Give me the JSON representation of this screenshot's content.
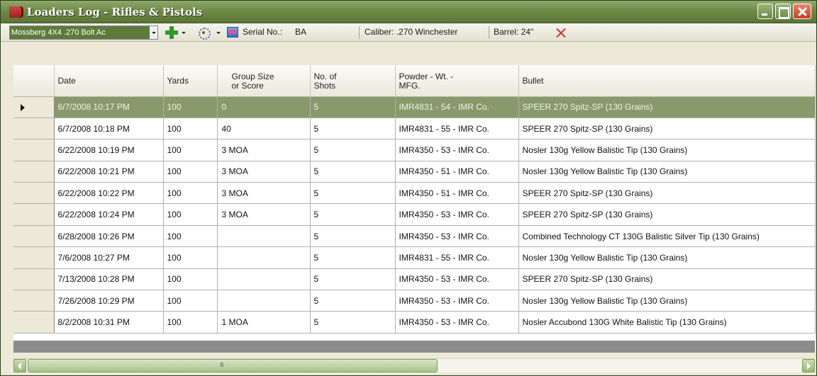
{
  "window": {
    "title": "Loaders Log - Rifles & Pistols"
  },
  "toolbar": {
    "firearm": "Mossberg 4X4 .270 Bolt Ac",
    "serial_label": "Serial No.:",
    "serial_value": "BA",
    "caliber": "Caliber: .270 Winchester",
    "barrel": "Barrel: 24\""
  },
  "columns": [
    "Date",
    "Yards",
    "Group Size\nor Score",
    "No. of\nShots",
    "Powder - Wt. -\nMFG.",
    "Bullet"
  ],
  "rows": [
    {
      "date": "6/7/2008 10:17 PM",
      "yards": "100",
      "group": "0",
      "shots": "5",
      "powder": "IMR4831 - 54 - IMR Co.",
      "bullet": "SPEER 270 Spitz-SP (130 Grains)"
    },
    {
      "date": "6/7/2008 10:18 PM",
      "yards": "100",
      "group": "40",
      "shots": "5",
      "powder": "IMR4831 - 55 - IMR Co.",
      "bullet": "SPEER 270 Spitz-SP (130 Grains)"
    },
    {
      "date": "6/22/2008 10:19 PM",
      "yards": "100",
      "group": "3 MOA",
      "shots": "5",
      "powder": "IMR4350 - 53 - IMR Co.",
      "bullet": "Nosler 130g Yellow Balistic Tip (130 Grains)"
    },
    {
      "date": "6/22/2008 10:21 PM",
      "yards": "100",
      "group": "3 MOA",
      "shots": "5",
      "powder": "IMR4350 - 51 - IMR Co.",
      "bullet": "Nosler 130g Yellow Balistic Tip (130 Grains)"
    },
    {
      "date": "6/22/2008 10:22 PM",
      "yards": "100",
      "group": "3 MOA",
      "shots": "5",
      "powder": "IMR4350 - 51 - IMR Co.",
      "bullet": "SPEER 270 Spitz-SP (130 Grains)"
    },
    {
      "date": "6/22/2008 10:24 PM",
      "yards": "100",
      "group": "3 MOA",
      "shots": "5",
      "powder": "IMR4350 - 53 - IMR Co.",
      "bullet": "SPEER 270 Spitz-SP (130 Grains)"
    },
    {
      "date": "6/28/2008 10:26 PM",
      "yards": "100",
      "group": "",
      "shots": "5",
      "powder": "IMR4350 - 53 - IMR Co.",
      "bullet": "Combined Technology CT 130G Balistic Silver Tip (130 Grains)"
    },
    {
      "date": "7/6/2008 10:27 PM",
      "yards": "100",
      "group": "",
      "shots": "5",
      "powder": "IMR4831 - 55 - IMR Co.",
      "bullet": "Nosler 130g Yellow Balistic Tip (130 Grains)"
    },
    {
      "date": "7/13/2008 10:28 PM",
      "yards": "100",
      "group": "",
      "shots": "5",
      "powder": "IMR4350 - 53 - IMR Co.",
      "bullet": "SPEER 270 Spitz-SP (130 Grains)"
    },
    {
      "date": "7/26/2008 10:29 PM",
      "yards": "100",
      "group": "",
      "shots": "5",
      "powder": "IMR4350 - 53 - IMR Co.",
      "bullet": "Nosler 130g Yellow Balistic Tip (130 Grains)"
    },
    {
      "date": "8/2/2008 10:31 PM",
      "yards": "100",
      "group": "1 MOA",
      "shots": "5",
      "powder": "IMR4350 - 53 - IMR Co.",
      "bullet": "Nosler Accubond 130G White Balistic Tip (130 Grains)"
    }
  ],
  "selected_row": 0,
  "colors": {
    "title_bar": "#6f8a48",
    "selected_row": "#889a6c",
    "delete_icon": "#d0322f",
    "add_icon": "#2f9a2a"
  },
  "icons": [
    "app-book-icon",
    "add-icon",
    "target-icon",
    "serial-icon",
    "delete-icon"
  ]
}
